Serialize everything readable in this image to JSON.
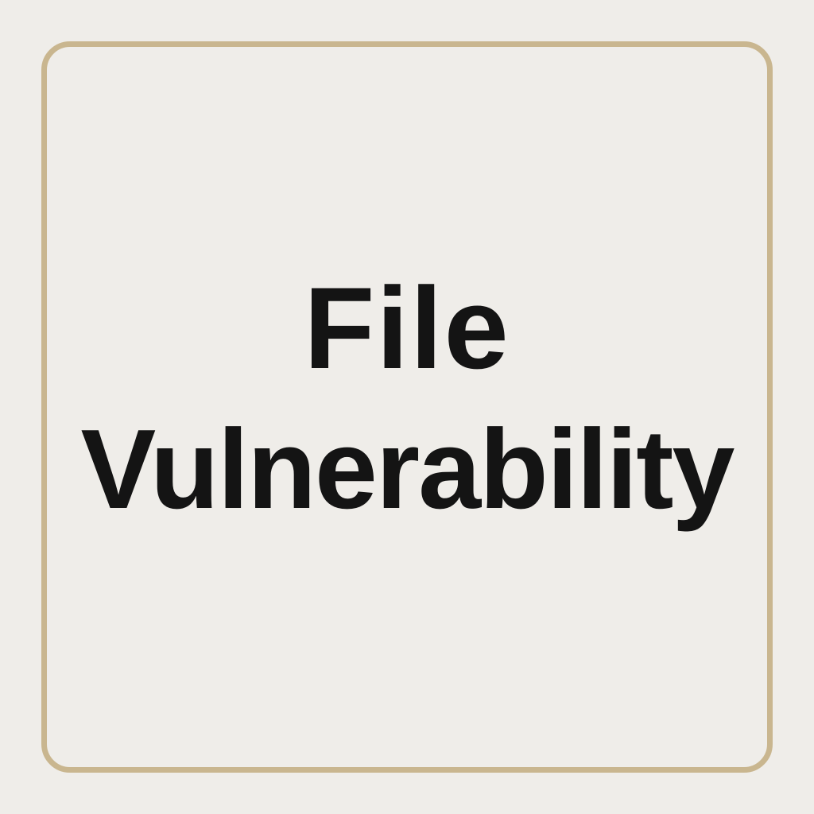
{
  "card": {
    "title_line_1": "File",
    "title_line_2": "Vulnerability"
  },
  "colors": {
    "background": "#efede9",
    "border": "#c9b68f",
    "text": "#141414"
  }
}
